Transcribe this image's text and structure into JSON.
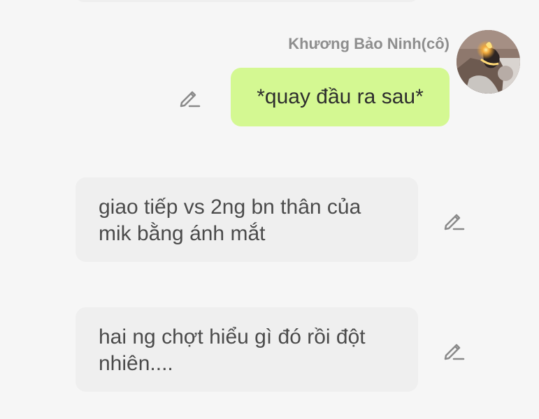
{
  "conversation": {
    "sent_message": {
      "sender_name": "Khương Bảo Ninh(cô)",
      "text": "*quay đầu ra sau*",
      "bubble_color": "#d4f892",
      "avatar_icon": "user-avatar-photo"
    },
    "received_messages": [
      {
        "text": "giao tiếp vs 2ng bn thân của mik bằng ánh mắt",
        "bubble_color": "#efefef"
      },
      {
        "text": "hai ng chợt hiểu gì đó rồi đột nhiên....",
        "bubble_color": "#efefef"
      }
    ],
    "action_icon": "pencil-icon"
  },
  "colors": {
    "background": "#f6f6f6",
    "sender_name": "#8e8e8e",
    "icon": "#8a8a8a"
  }
}
